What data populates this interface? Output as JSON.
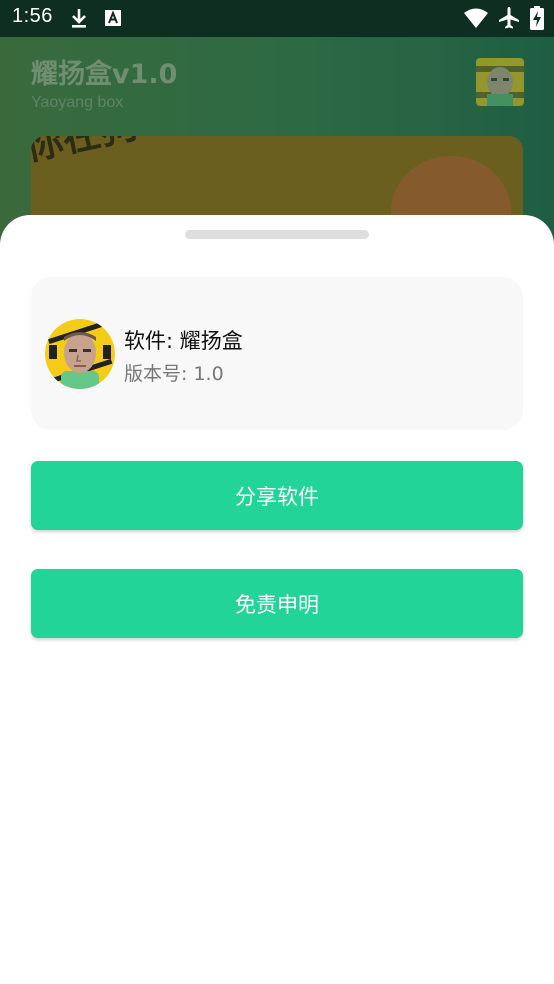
{
  "status_bar": {
    "time": "1:56",
    "icons": [
      "download-icon",
      "a-notification-icon",
      "wifi-icon",
      "airplane-mode-icon",
      "battery-charging-icon"
    ]
  },
  "background_app": {
    "title": "耀扬盒v1.0",
    "subtitle": "Yaoyang box",
    "banner_text": "你在狗叫什么 你在狗叫什么 你在狗叫什么"
  },
  "sheet": {
    "software_label": "软件: 耀扬盒",
    "version_label": "版本号: 1.0",
    "share_button": "分享软件",
    "disclaimer_button": "免责申明"
  },
  "colors": {
    "accent": "#22d497",
    "status_bar_bg": "#0f2e22",
    "sheet_bg": "#ffffff",
    "card_bg": "#f8f8f8"
  }
}
